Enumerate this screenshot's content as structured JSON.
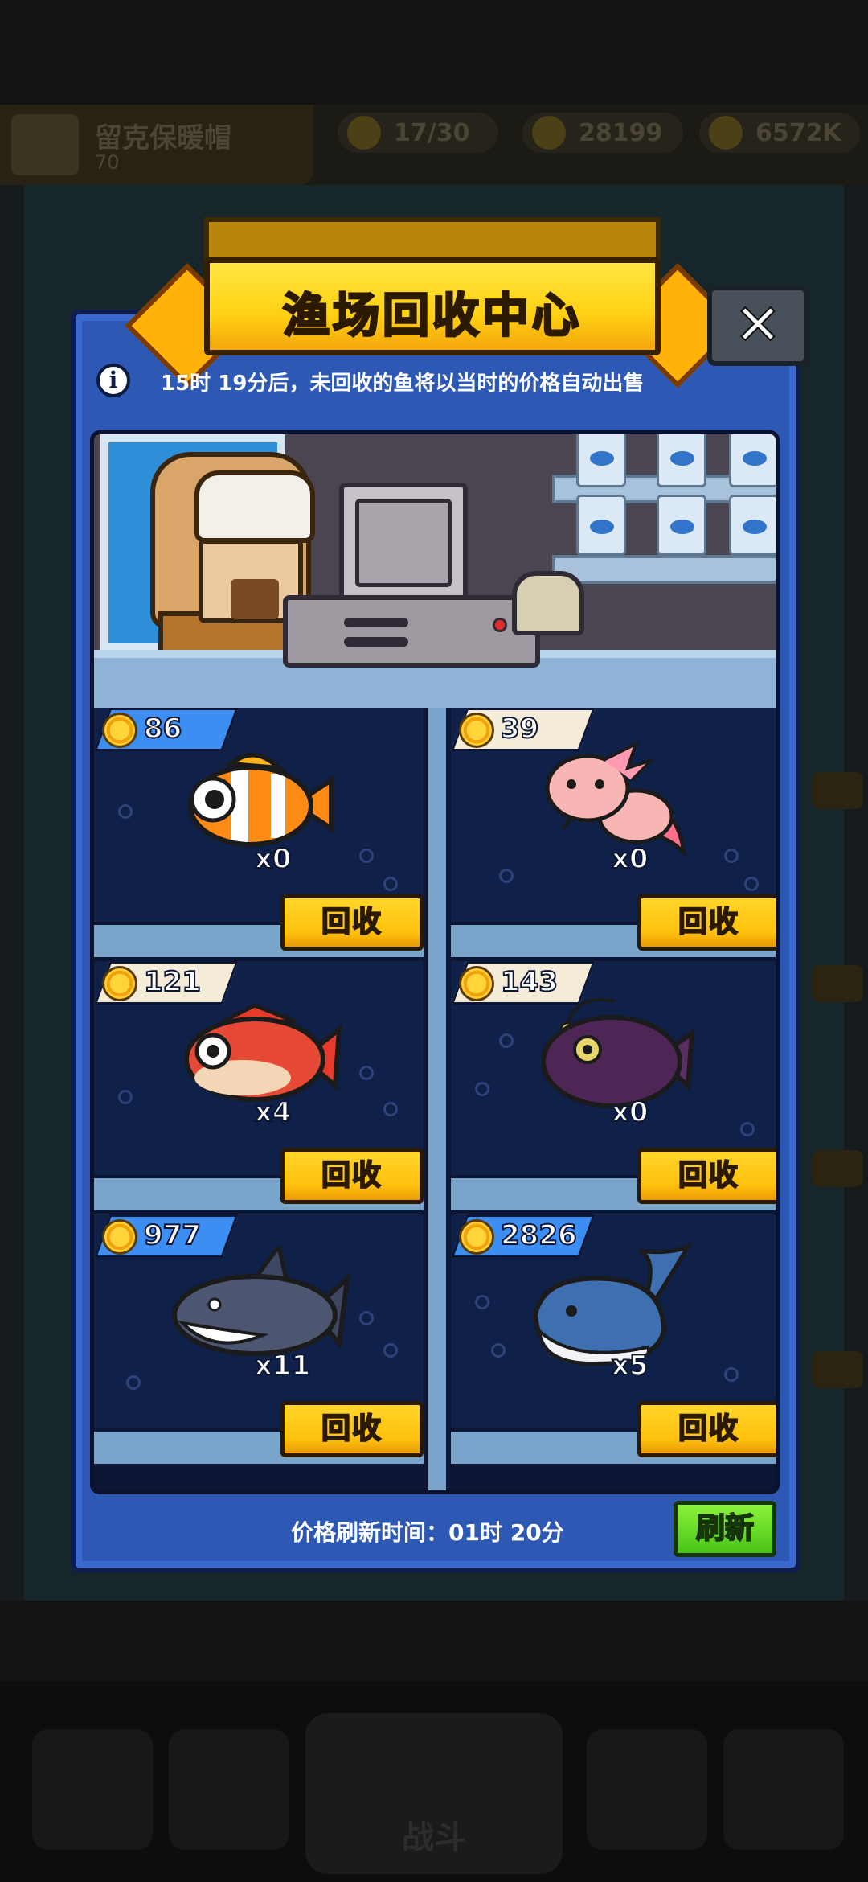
{
  "background": {
    "player_name": "留克保暖帽",
    "player_level": "70",
    "resources": [
      "17/30",
      "28199",
      "6572K"
    ],
    "battle_tab_label": "战斗"
  },
  "dialog": {
    "title": "渔场回收中心",
    "close_label": "✕",
    "info_icon_label": "i",
    "notice": "15时 19分后，未回收的鱼将以当时的价格自动出售",
    "sell_label": "回收",
    "refresh_time": "价格刷新时间：01时 20分",
    "refresh_label": "刷新"
  },
  "fish_items": [
    {
      "name": "clownfish",
      "price": "86",
      "count": "x0",
      "tag_color": "#3d8ef3"
    },
    {
      "name": "axolotl",
      "price": "39",
      "count": "x0",
      "tag_color": "#f4ecd8"
    },
    {
      "name": "red-snapper",
      "price": "121",
      "count": "x4",
      "tag_color": "#f4ecd8"
    },
    {
      "name": "anglerfish",
      "price": "143",
      "count": "x0",
      "tag_color": "#f4ecd8"
    },
    {
      "name": "shark",
      "price": "977",
      "count": "x11",
      "tag_color": "#3d8ef3"
    },
    {
      "name": "whale",
      "price": "2826",
      "count": "x5",
      "tag_color": "#3d8ef3"
    }
  ],
  "colors": {
    "panel_blue": "#2d58b4",
    "title_yellow": "#ffd012",
    "sell_yellow": "#ffc10d",
    "refresh_green": "#49c418"
  }
}
